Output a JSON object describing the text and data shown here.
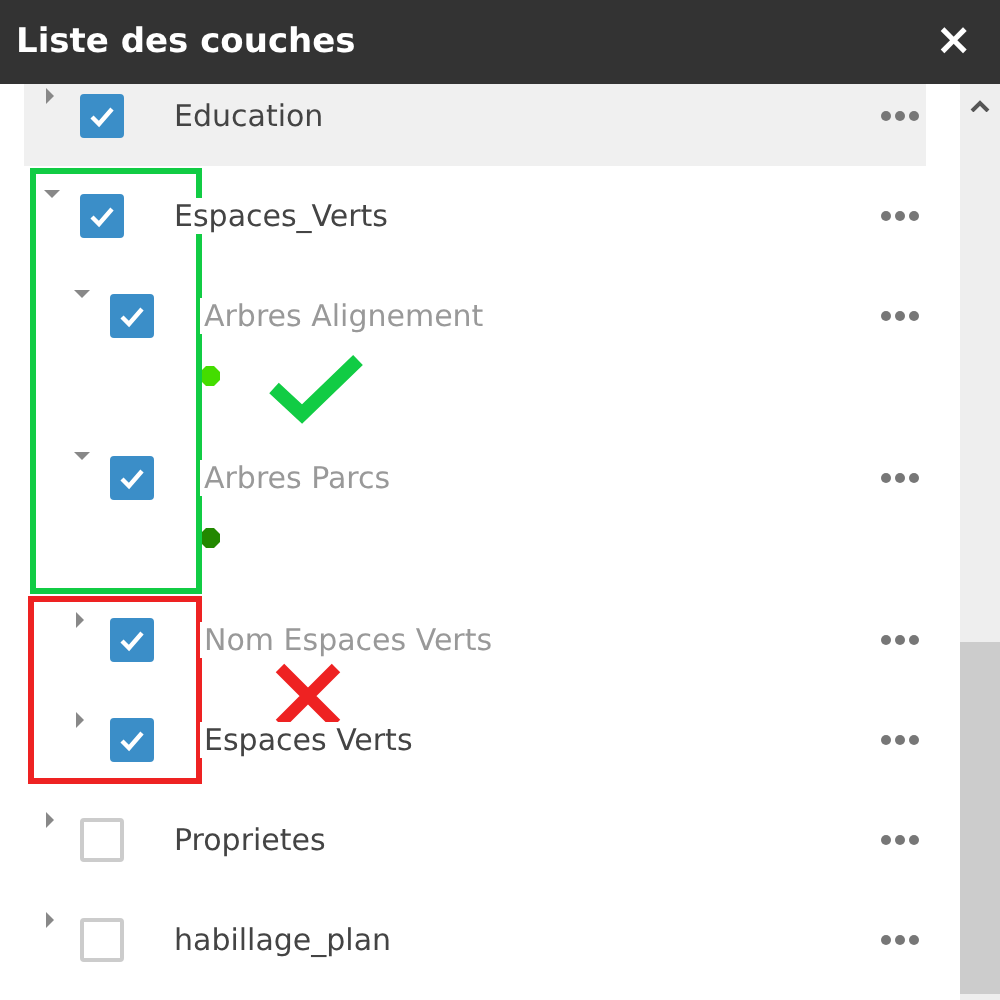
{
  "panel": {
    "title": "Liste des couches",
    "close": "×"
  },
  "layers": [
    {
      "name": "Education",
      "checked": true,
      "expanded": false,
      "selected": true,
      "dimmed": false
    },
    {
      "name": "Espaces_Verts",
      "checked": true,
      "expanded": true,
      "selected": false,
      "dimmed": false,
      "children": [
        {
          "name": "Arbres Alignement",
          "checked": true,
          "expanded": true,
          "selected": false,
          "dimmed": true,
          "color": "#44dd00"
        },
        {
          "name": "Arbres Parcs",
          "checked": true,
          "expanded": true,
          "selected": false,
          "dimmed": true,
          "color": "#228800"
        },
        {
          "name": "Nom Espaces Verts",
          "checked": true,
          "expanded": false,
          "selected": false,
          "dimmed": true
        },
        {
          "name": "Espaces Verts",
          "checked": true,
          "expanded": false,
          "selected": false,
          "dimmed": false
        }
      ]
    },
    {
      "name": "Proprietes",
      "checked": false,
      "expanded": false,
      "selected": false,
      "dimmed": false
    },
    {
      "name": "habillage_plan",
      "checked": false,
      "expanded": false,
      "selected": false,
      "dimmed": false
    }
  ]
}
